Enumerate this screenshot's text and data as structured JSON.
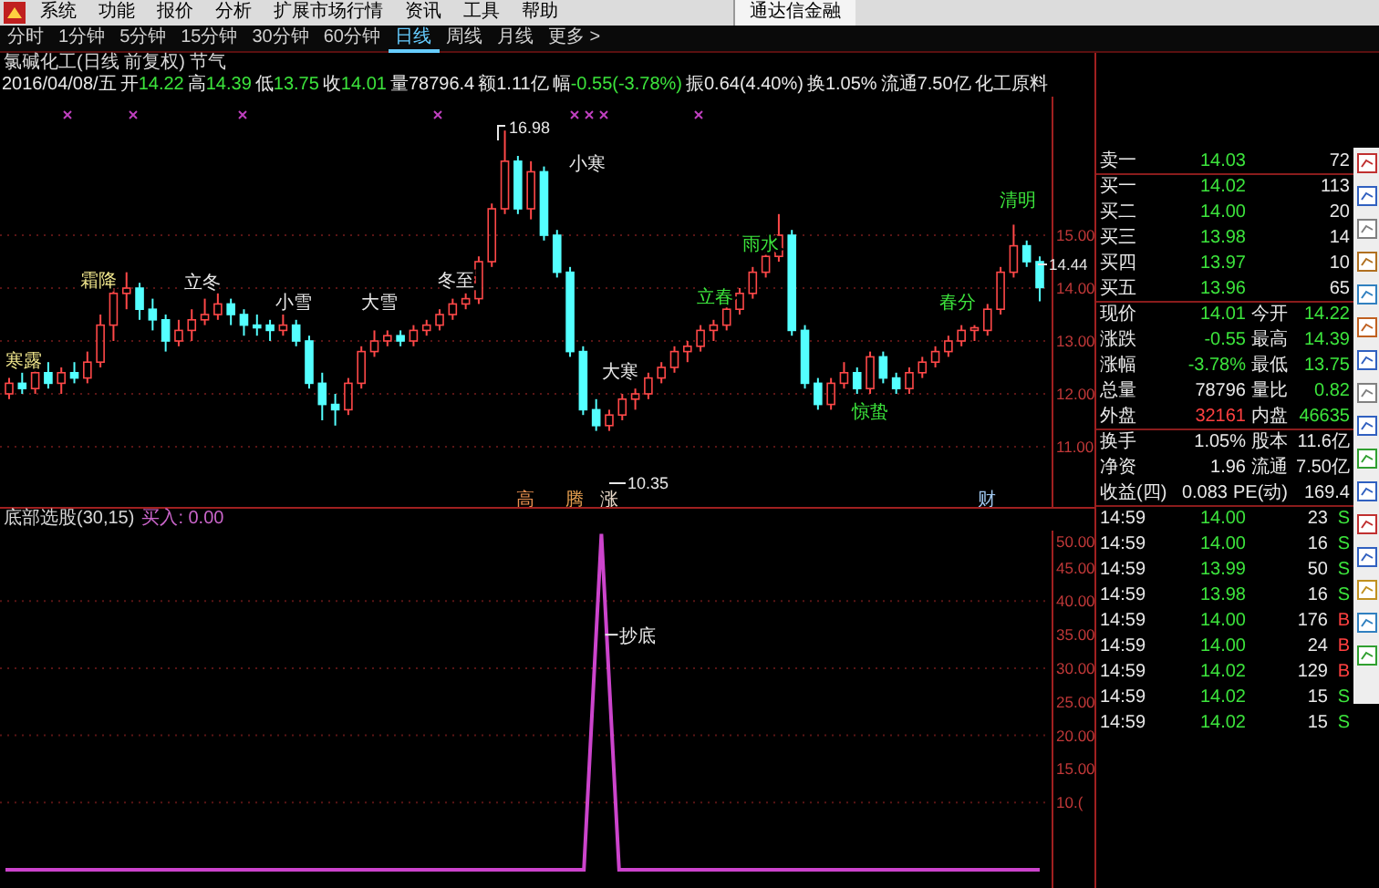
{
  "menu": {
    "items": [
      "系统",
      "功能",
      "报价",
      "分析",
      "扩展市场行情",
      "资讯",
      "工具",
      "帮助"
    ],
    "app_title": "通达信金融"
  },
  "periods": [
    {
      "label": "分时",
      "selected": false
    },
    {
      "label": "1分钟",
      "selected": false
    },
    {
      "label": "5分钟",
      "selected": false
    },
    {
      "label": "15分钟",
      "selected": false
    },
    {
      "label": "30分钟",
      "selected": false
    },
    {
      "label": "60分钟",
      "selected": false
    },
    {
      "label": "日线",
      "selected": true
    },
    {
      "label": "周线",
      "selected": false
    },
    {
      "label": "月线",
      "selected": false
    },
    {
      "label": "更多 >",
      "selected": false
    }
  ],
  "chart": {
    "title": "氯碱化工(日线 前复权) 节气",
    "date": "2016/04/08/五",
    "info": [
      {
        "label": "开",
        "value": "14.22",
        "color": "#3ce43c"
      },
      {
        "label": "高",
        "value": "14.39",
        "color": "#3ce43c"
      },
      {
        "label": "低",
        "value": "13.75",
        "color": "#3ce43c"
      },
      {
        "label": "收",
        "value": "14.01",
        "color": "#3ce43c"
      },
      {
        "label": "量",
        "value": "78796.4",
        "color": "#e8e8e8"
      },
      {
        "label": "额",
        "value": "1.11亿",
        "color": "#e8e8e8"
      },
      {
        "label": "幅",
        "value": "-0.55(-3.78%)",
        "color": "#3ce43c"
      },
      {
        "label": "振",
        "value": "0.64(4.40%)",
        "color": "#e8e8e8"
      },
      {
        "label": "换",
        "value": "1.05%",
        "color": "#e8e8e8"
      },
      {
        "label": "流通",
        "value": "7.50亿",
        "color": "#e8e8e8"
      }
    ],
    "sector": "化工原料",
    "chart_data": {
      "type": "candlestick",
      "ylim": [
        9.862,
        17.621
      ],
      "ohlc": [
        [
          12.0,
          12.3,
          11.9,
          12.2
        ],
        [
          12.2,
          12.4,
          12.0,
          12.1
        ],
        [
          12.1,
          12.5,
          12.0,
          12.4
        ],
        [
          12.4,
          12.6,
          12.1,
          12.2
        ],
        [
          12.2,
          12.5,
          12.0,
          12.4
        ],
        [
          12.4,
          12.6,
          12.2,
          12.3
        ],
        [
          12.3,
          12.8,
          12.2,
          12.6
        ],
        [
          12.6,
          13.5,
          12.5,
          13.3
        ],
        [
          13.3,
          14.0,
          13.0,
          13.9
        ],
        [
          13.9,
          14.3,
          13.6,
          14.0
        ],
        [
          14.0,
          14.1,
          13.4,
          13.6
        ],
        [
          13.6,
          13.8,
          13.2,
          13.4
        ],
        [
          13.4,
          13.5,
          12.8,
          13.0
        ],
        [
          13.0,
          13.4,
          12.9,
          13.2
        ],
        [
          13.2,
          13.6,
          13.0,
          13.4
        ],
        [
          13.4,
          13.8,
          13.3,
          13.5
        ],
        [
          13.5,
          13.9,
          13.4,
          13.7
        ],
        [
          13.7,
          13.8,
          13.3,
          13.5
        ],
        [
          13.5,
          13.6,
          13.1,
          13.3
        ],
        [
          13.3,
          13.5,
          13.1,
          13.25
        ],
        [
          13.3,
          13.4,
          13.0,
          13.2
        ],
        [
          13.2,
          13.5,
          13.1,
          13.3
        ],
        [
          13.3,
          13.4,
          12.9,
          13.0
        ],
        [
          13.0,
          13.1,
          12.1,
          12.2
        ],
        [
          12.2,
          12.4,
          11.5,
          11.8
        ],
        [
          11.8,
          12.0,
          11.4,
          11.7
        ],
        [
          11.7,
          12.3,
          11.6,
          12.2
        ],
        [
          12.2,
          12.9,
          12.1,
          12.8
        ],
        [
          12.8,
          13.2,
          12.7,
          13.0
        ],
        [
          13.0,
          13.2,
          12.9,
          13.1
        ],
        [
          13.1,
          13.2,
          12.9,
          13.0
        ],
        [
          13.0,
          13.3,
          12.9,
          13.2
        ],
        [
          13.2,
          13.4,
          13.1,
          13.3
        ],
        [
          13.3,
          13.6,
          13.2,
          13.5
        ],
        [
          13.5,
          13.8,
          13.4,
          13.7
        ],
        [
          13.7,
          13.9,
          13.6,
          13.8
        ],
        [
          13.8,
          14.6,
          13.7,
          14.5
        ],
        [
          14.5,
          15.6,
          14.4,
          15.5
        ],
        [
          15.5,
          16.98,
          15.4,
          16.4
        ],
        [
          16.4,
          16.5,
          15.4,
          15.5
        ],
        [
          15.5,
          16.4,
          15.3,
          16.2
        ],
        [
          16.2,
          16.3,
          14.9,
          15.0
        ],
        [
          15.0,
          15.1,
          14.2,
          14.3
        ],
        [
          14.3,
          14.4,
          12.7,
          12.8
        ],
        [
          12.8,
          12.9,
          11.6,
          11.7
        ],
        [
          11.7,
          11.9,
          11.3,
          11.4
        ],
        [
          11.4,
          11.7,
          11.3,
          11.6
        ],
        [
          11.6,
          12.0,
          11.5,
          11.9
        ],
        [
          11.9,
          12.1,
          11.7,
          12.0
        ],
        [
          12.0,
          12.4,
          11.9,
          12.3
        ],
        [
          12.3,
          12.6,
          12.2,
          12.5
        ],
        [
          12.5,
          12.9,
          12.4,
          12.8
        ],
        [
          12.8,
          13.0,
          12.6,
          12.9
        ],
        [
          12.9,
          13.3,
          12.8,
          13.2
        ],
        [
          13.2,
          13.4,
          13.0,
          13.3
        ],
        [
          13.3,
          13.7,
          13.2,
          13.6
        ],
        [
          13.6,
          14.0,
          13.5,
          13.9
        ],
        [
          13.9,
          14.4,
          13.8,
          14.3
        ],
        [
          14.3,
          14.7,
          14.2,
          14.6
        ],
        [
          14.6,
          15.4,
          14.5,
          15.0
        ],
        [
          15.0,
          15.1,
          13.1,
          13.2
        ],
        [
          13.2,
          13.3,
          12.1,
          12.2
        ],
        [
          12.2,
          12.3,
          11.7,
          11.8
        ],
        [
          11.8,
          12.3,
          11.7,
          12.2
        ],
        [
          12.2,
          12.6,
          12.1,
          12.4
        ],
        [
          12.4,
          12.5,
          12.0,
          12.1
        ],
        [
          12.1,
          12.8,
          12.0,
          12.7
        ],
        [
          12.7,
          12.8,
          12.2,
          12.3
        ],
        [
          12.3,
          12.4,
          12.0,
          12.1
        ],
        [
          12.1,
          12.5,
          12.0,
          12.4
        ],
        [
          12.4,
          12.7,
          12.3,
          12.6
        ],
        [
          12.6,
          12.9,
          12.5,
          12.8
        ],
        [
          12.8,
          13.1,
          12.7,
          13.0
        ],
        [
          13.0,
          13.3,
          12.9,
          13.2
        ],
        [
          13.2,
          13.3,
          13.0,
          13.25
        ],
        [
          13.2,
          13.7,
          13.1,
          13.6
        ],
        [
          13.6,
          14.4,
          13.5,
          14.3
        ],
        [
          14.3,
          15.2,
          14.2,
          14.8
        ],
        [
          14.8,
          14.9,
          14.4,
          14.5
        ],
        [
          14.5,
          14.6,
          13.75,
          14.01
        ]
      ],
      "yticks": [
        {
          "value": 15,
          "label": "15.00"
        },
        {
          "value": 14,
          "label": "14.00"
        },
        {
          "value": 13,
          "label": "13.00"
        },
        {
          "value": 12,
          "label": "12.00"
        },
        {
          "value": 11,
          "label": "11.00"
        }
      ],
      "grid": true
    },
    "term_labels": [
      {
        "text": "寒露",
        "color": "#f0e68c"
      },
      {
        "text": "霜降",
        "color": "#f0e68c"
      },
      {
        "text": "立冬",
        "color": "#e8e8e8"
      },
      {
        "text": "小雪",
        "color": "#e8e8e8"
      },
      {
        "text": "大雪",
        "color": "#e8e8e8"
      },
      {
        "text": "冬至",
        "color": "#e8e8e8"
      },
      {
        "text": "小寒",
        "color": "#e8e8e8"
      },
      {
        "text": "大寒",
        "color": "#e8e8e8"
      },
      {
        "text": "立春",
        "color": "#3ce43c"
      },
      {
        "text": "雨水",
        "color": "#3ce43c"
      },
      {
        "text": "惊蛰",
        "color": "#3ce43c"
      },
      {
        "text": "春分",
        "color": "#3ce43c"
      },
      {
        "text": "清明",
        "color": "#3ce43c"
      }
    ],
    "price_marks": [
      "16.98",
      "14.44",
      "10.35"
    ],
    "signal_marks": [
      {
        "text": "高",
        "color": "#e89050"
      },
      {
        "text": "腾",
        "color": "#e8a050"
      },
      {
        "text": "涨",
        "color": "#e8d8c8"
      },
      {
        "text": "财",
        "color": "#a0c8f0"
      }
    ]
  },
  "indicator": {
    "name": "底部选股(30,15)",
    "signal": "买入: 0.00",
    "chart_data": {
      "type": "line",
      "color": "#cc44cc",
      "values": [
        0,
        0,
        0,
        0,
        0,
        0,
        0,
        0,
        0,
        0,
        0,
        0,
        0,
        0,
        0,
        0,
        0,
        0,
        0,
        0,
        0,
        0,
        0,
        0,
        0,
        0,
        0,
        0,
        0,
        0,
        0,
        0,
        0,
        0,
        50,
        0,
        0,
        0,
        0,
        0,
        0,
        0,
        0,
        0,
        0,
        0,
        0,
        0,
        0,
        0,
        0,
        0,
        0,
        0,
        0,
        0,
        0,
        0,
        0,
        0
      ],
      "ylim": [
        -3,
        50.5
      ],
      "yticks": [
        {
          "value": 50,
          "label": "50.00"
        },
        {
          "value": 45,
          "label": "45.00"
        },
        {
          "value": 40,
          "label": "40.00"
        },
        {
          "value": 35,
          "label": "35.00"
        },
        {
          "value": 30,
          "label": "30.00"
        },
        {
          "value": 25,
          "label": "25.00"
        },
        {
          "value": 20,
          "label": "20.00"
        },
        {
          "value": 15,
          "label": "15.00"
        },
        {
          "value": 10,
          "label": "10.("
        }
      ],
      "grid": true,
      "annotations": [
        "抄底"
      ]
    }
  },
  "quote": {
    "sell": [
      {
        "label": "卖一",
        "price": "14.03",
        "volume": "72"
      }
    ],
    "buy": [
      {
        "label": "买一",
        "price": "14.02",
        "volume": "113"
      },
      {
        "label": "买二",
        "price": "14.00",
        "volume": "20"
      },
      {
        "label": "买三",
        "price": "13.98",
        "volume": "14"
      },
      {
        "label": "买四",
        "price": "13.97",
        "volume": "10"
      },
      {
        "label": "买五",
        "price": "13.96",
        "volume": "65"
      }
    ],
    "stats": [
      [
        {
          "label": "现价",
          "value": "14.01",
          "color": "#3ce43c"
        },
        {
          "label": "今开",
          "value": "14.22",
          "color": "#3ce43c"
        }
      ],
      [
        {
          "label": "涨跌",
          "value": "-0.55",
          "color": "#3ce43c"
        },
        {
          "label": "最高",
          "value": "14.39",
          "color": "#3ce43c"
        }
      ],
      [
        {
          "label": "涨幅",
          "value": "-3.78%",
          "color": "#3ce43c"
        },
        {
          "label": "最低",
          "value": "13.75",
          "color": "#3ce43c"
        }
      ],
      [
        {
          "label": "总量",
          "value": "78796",
          "color": "#e8e8e8"
        },
        {
          "label": "量比",
          "value": "0.82",
          "color": "#3ce43c"
        }
      ],
      [
        {
          "label": "外盘",
          "value": "32161",
          "color": "#ff4040"
        },
        {
          "label": "内盘",
          "value": "46635",
          "color": "#3ce43c"
        }
      ]
    ],
    "stats2": [
      [
        {
          "label": "换手",
          "value": "1.05%",
          "color": "#e8e8e8"
        },
        {
          "label": "股本",
          "value": "11.6亿",
          "color": "#e8e8e8"
        }
      ],
      [
        {
          "label": "净资",
          "value": "1.96",
          "color": "#e8e8e8"
        },
        {
          "label": "流通",
          "value": "7.50亿",
          "color": "#e8e8e8"
        }
      ],
      [
        {
          "label": "收益(四)",
          "value": "0.083",
          "color": "#e8e8e8"
        },
        {
          "label": "PE(动)",
          "value": "169.4",
          "color": "#e8e8e8"
        }
      ]
    ],
    "ticks": [
      {
        "time": "14:59",
        "price": "14.00",
        "volume": "23",
        "side": "S",
        "color": "#3ce43c"
      },
      {
        "time": "14:59",
        "price": "14.00",
        "volume": "16",
        "side": "S",
        "color": "#3ce43c"
      },
      {
        "time": "14:59",
        "price": "13.99",
        "volume": "50",
        "side": "S",
        "color": "#3ce43c"
      },
      {
        "time": "14:59",
        "price": "13.98",
        "volume": "16",
        "side": "S",
        "color": "#3ce43c"
      },
      {
        "time": "14:59",
        "price": "14.00",
        "volume": "176",
        "side": "B",
        "color": "#ff4040"
      },
      {
        "time": "14:59",
        "price": "14.00",
        "volume": "24",
        "side": "B",
        "color": "#ff4040"
      },
      {
        "time": "14:59",
        "price": "14.02",
        "volume": "129",
        "side": "B",
        "color": "#ff4040"
      },
      {
        "time": "14:59",
        "price": "14.02",
        "volume": "15",
        "side": "S",
        "color": "#3ce43c"
      },
      {
        "time": "14:59",
        "price": "14.02",
        "volume": "15",
        "side": "S",
        "color": "#3ce43c"
      }
    ]
  }
}
